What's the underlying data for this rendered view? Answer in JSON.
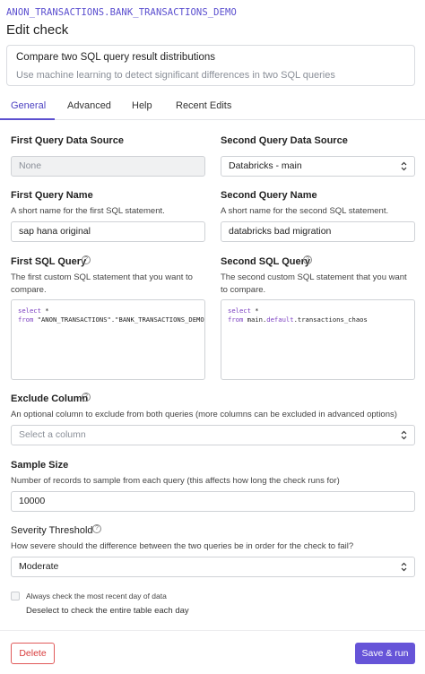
{
  "header": {
    "breadcrumb": "ANON_TRANSACTIONS.BANK_TRANSACTIONS_DEMO",
    "title": "Edit check"
  },
  "check_type": {
    "title": "Compare two SQL query result distributions",
    "description": "Use machine learning to detect significant differences in two SQL queries"
  },
  "tabs": [
    {
      "label": "General",
      "active": true
    },
    {
      "label": "Advanced",
      "active": false
    },
    {
      "label": "Help",
      "active": false
    },
    {
      "label": "Recent Edits",
      "active": false
    }
  ],
  "first_source": {
    "label": "First Query Data Source",
    "value": "None"
  },
  "second_source": {
    "label": "Second Query Data Source",
    "value": "Databricks - main"
  },
  "first_name": {
    "label": "First Query Name",
    "help": "A short name for the first SQL statement.",
    "value": "sap hana original"
  },
  "second_name": {
    "label": "Second Query Name",
    "help": "A short name for the second SQL statement.",
    "value": "databricks bad migration"
  },
  "first_sql": {
    "label": "First SQL Query",
    "help": "The first custom SQL statement that you want to compare.",
    "line1_kw": "select",
    "line1_rest": " *",
    "line2_kw": "from",
    "line2_rest": " \"ANON_TRANSACTIONS\".\"BANK_TRANSACTIONS_DEMO\""
  },
  "second_sql": {
    "label": "Second SQL Query",
    "help": "The second custom SQL statement that you want to compare.",
    "line1_kw": "select",
    "line1_rest": " *",
    "line2_kw": "from",
    "line2_main": " main.",
    "line2_default": "default",
    "line2_table": ".transactions_chaos"
  },
  "exclude_column": {
    "label": "Exclude Column",
    "help": "An optional column to exclude from both queries (more columns can be excluded in advanced options)",
    "placeholder": "Select a column"
  },
  "sample_size": {
    "label": "Sample Size",
    "help": "Number of records to sample from each query (this affects how long the check runs for)",
    "value": "10000"
  },
  "severity": {
    "label": "Severity Threshold",
    "help": "How severe should the difference between the two queries be in order for the check to fail?",
    "value": "Moderate"
  },
  "recent_day": {
    "label": "Always check the most recent day of data",
    "sub": "Deselect to check the entire table each day",
    "checked": false
  },
  "footer": {
    "delete_label": "Delete",
    "save_label": "Save & run"
  },
  "colors": {
    "accent": "#6654d8",
    "danger": "#d83b3b",
    "keyword": "#7b3fc0"
  },
  "icons": {
    "help": "question-circle-icon",
    "select": "chevron-up-down-icon"
  }
}
